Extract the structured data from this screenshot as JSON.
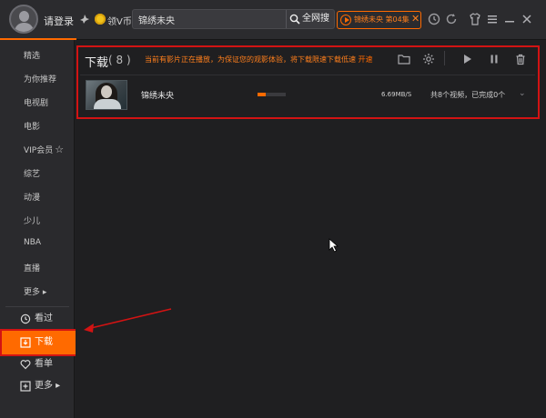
{
  "topbar": {
    "login_label": "请登录",
    "coin_label": "领V币",
    "search": {
      "value": "锦绣未央",
      "button_label": "全网搜"
    },
    "now_playing": {
      "title": "锦绣未央 第04集",
      "close_label": "✕"
    }
  },
  "sidebar": {
    "categories": [
      {
        "label": "精选"
      },
      {
        "label": "为你推荐"
      },
      {
        "label": "电视剧"
      },
      {
        "label": "电影"
      },
      {
        "label": "VIP会员"
      },
      {
        "label": "综艺"
      },
      {
        "label": "动漫"
      },
      {
        "label": "少儿"
      },
      {
        "label": "NBA"
      },
      {
        "label": "直播"
      },
      {
        "label": "更多 ▸"
      }
    ],
    "items": [
      {
        "label": "看过",
        "icon": "history-icon"
      },
      {
        "label": "下载",
        "icon": "download-icon",
        "active": true
      },
      {
        "label": "看单",
        "icon": "heart-list-icon"
      },
      {
        "label": "更多 ▸",
        "icon": "plus-square-icon"
      }
    ]
  },
  "main": {
    "title": "下载",
    "count": "( 8 )",
    "notice": "当前有影片正在播放，为保证您的观影体验，将下载限速下载低速",
    "notice_link": "开速",
    "toolbar_icons": [
      "folder-icon",
      "settings-icon",
      "play-icon",
      "pause-icon",
      "trash-icon"
    ],
    "download_item": {
      "title": "锦绣未央",
      "progress": 0.3,
      "speed": "6.69MB/S",
      "status": "共8个视频，已完成0个"
    }
  },
  "colors": {
    "accent": "#ff6a00",
    "annotation": "#d21313",
    "background": "#1f1f21"
  }
}
